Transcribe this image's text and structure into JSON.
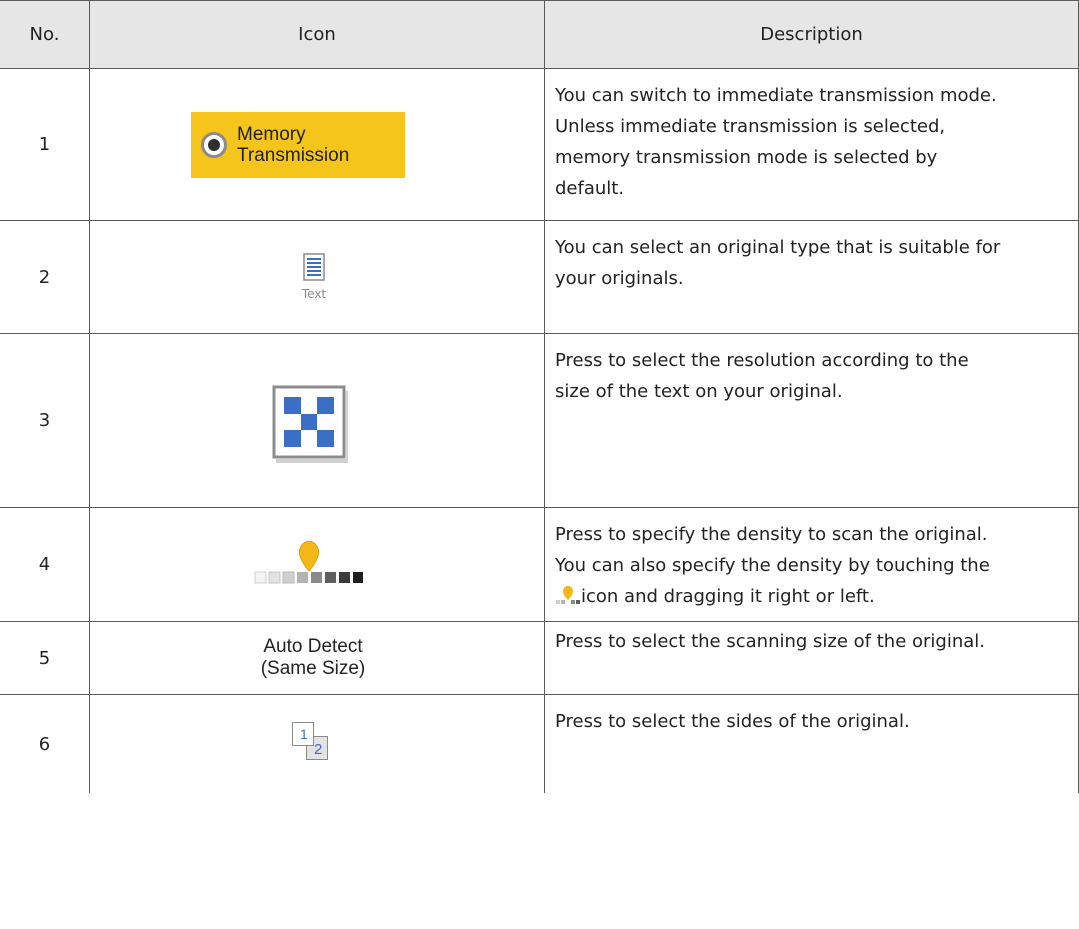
{
  "table": {
    "headers": {
      "no": "No.",
      "icon": "Icon",
      "description": "Description"
    },
    "rows": [
      {
        "no": "1",
        "icon_name": "memory-transmission-icon",
        "icon_text": [
          "Memory",
          "Transmission"
        ],
        "description": [
          "You can switch to immediate transmission mode.",
          "Unless immediate transmission is selected,",
          "memory transmission mode is selected by",
          "default."
        ]
      },
      {
        "no": "2",
        "icon_name": "original-type-text-icon",
        "icon_text": [
          "Text"
        ],
        "description": [
          "You can select an original type that is suitable for",
          "your originals."
        ]
      },
      {
        "no": "3",
        "icon_name": "resolution-icon",
        "description": [
          "Press to select the resolution according to the",
          "size of the text on your original."
        ]
      },
      {
        "no": "4",
        "icon_name": "density-slider-icon",
        "description": [
          "Press to specify the density to scan the original.",
          "You can also specify the density by touching the",
          "icon and dragging it right or left."
        ]
      },
      {
        "no": "5",
        "icon_name": "scan-size-icon",
        "icon_text": [
          "Auto Detect",
          "(Same Size)"
        ],
        "description": [
          "Press to select the scanning size of the original."
        ]
      },
      {
        "no": "6",
        "icon_name": "original-sides-icon",
        "icon_text": [
          "1",
          "2"
        ],
        "description": [
          "Press to select the sides of the original."
        ]
      }
    ]
  },
  "colors": {
    "header_bg": "#e6e6e6",
    "accent_yellow": "#f5c51c",
    "accent_blue": "#3b6fc6",
    "border": "#5a5a5a"
  }
}
